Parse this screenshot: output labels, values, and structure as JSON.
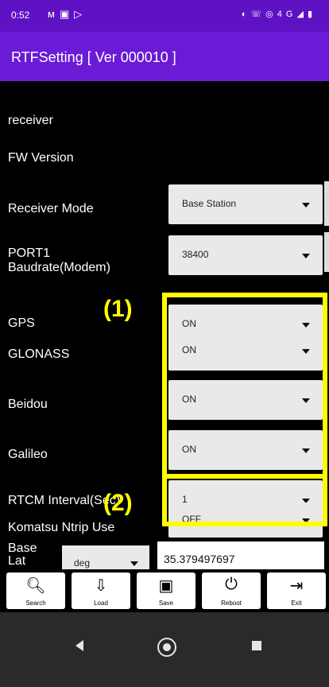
{
  "status_bar": {
    "time": "0:52",
    "left_icons": [
      "m-icon",
      "message-icon",
      "play-icon"
    ],
    "right_icons": [
      "vibrate-icon",
      "wifi-call-icon",
      "hotspot-icon",
      "4G",
      "signal-icon",
      "battery-icon"
    ]
  },
  "app": {
    "title": "RTFSetting  [ Ver 000010 ]"
  },
  "rows": {
    "receiver": {
      "label": "receiver"
    },
    "fw_version": {
      "label": "FW Version"
    },
    "receiver_mode": {
      "label": "Receiver Mode",
      "value": "Base Station"
    },
    "port1": {
      "label_line1": "PORT1",
      "label_line2": "Baudrate(Modem)",
      "value": "38400"
    },
    "gps": {
      "label": "GPS",
      "value": "ON"
    },
    "glonass": {
      "label": "GLONASS",
      "value": "ON"
    },
    "beidou": {
      "label": "Beidou",
      "value": "ON"
    },
    "galileo": {
      "label": "Galileo",
      "value": "ON"
    },
    "rtcm": {
      "label": "RTCM Interval(Sec)",
      "value": "1"
    },
    "ntrip": {
      "label": "Komatsu Ntrip Use",
      "value": "OFF"
    },
    "base_lat": {
      "label_line1": "Base",
      "label_line2": "Lat",
      "unit": "deg",
      "value": "35.379497697"
    }
  },
  "annotations": {
    "one": "(1)",
    "two": "(2)",
    "highlight_color": "#ffff00"
  },
  "toolbar": [
    {
      "icon": "search-icon",
      "label": "Search"
    },
    {
      "icon": "load-icon",
      "label": "Load"
    },
    {
      "icon": "save-icon",
      "label": "Save"
    },
    {
      "icon": "power-icon",
      "label": "Reboot"
    },
    {
      "icon": "exit-icon",
      "label": "Exit"
    }
  ],
  "colors": {
    "app_bar": "#6a1bd6",
    "status_bar": "#5f12c4",
    "background": "#000000"
  }
}
